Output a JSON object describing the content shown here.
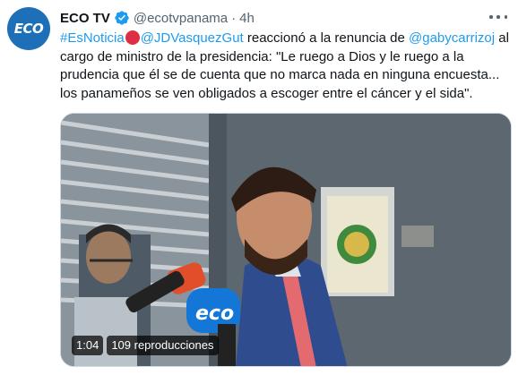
{
  "account": {
    "name": "ECO TV",
    "handle": "@ecotvpanama",
    "separator": "·",
    "time": "4h",
    "avatar_text": "ECO",
    "verified_icon": "verified-badge-icon"
  },
  "tweet": {
    "hashtag": "#EsNoticia",
    "mention1": "@JDVasquezGut",
    "text1": " reaccionó a la renuncia de ",
    "mention2": "@gabycarrizoj",
    "text2": " al cargo de ministro de la presidencia: \"Le ruego a Dios y le ruego a la prudencia que él se de cuenta que no marca nada en ninguna encuesta... los panameños se ven obligados a escoger entre el cáncer y el sida\"."
  },
  "media": {
    "duration": "1:04",
    "views": "109 reproducciones",
    "mic_logo": "eco"
  },
  "colors": {
    "link": "#1d9bf0",
    "avatar_bg": "#1d6fb8",
    "red_dot": "#dd2e44",
    "suit": "#2f4c8f",
    "tie": "#e36a6e"
  }
}
